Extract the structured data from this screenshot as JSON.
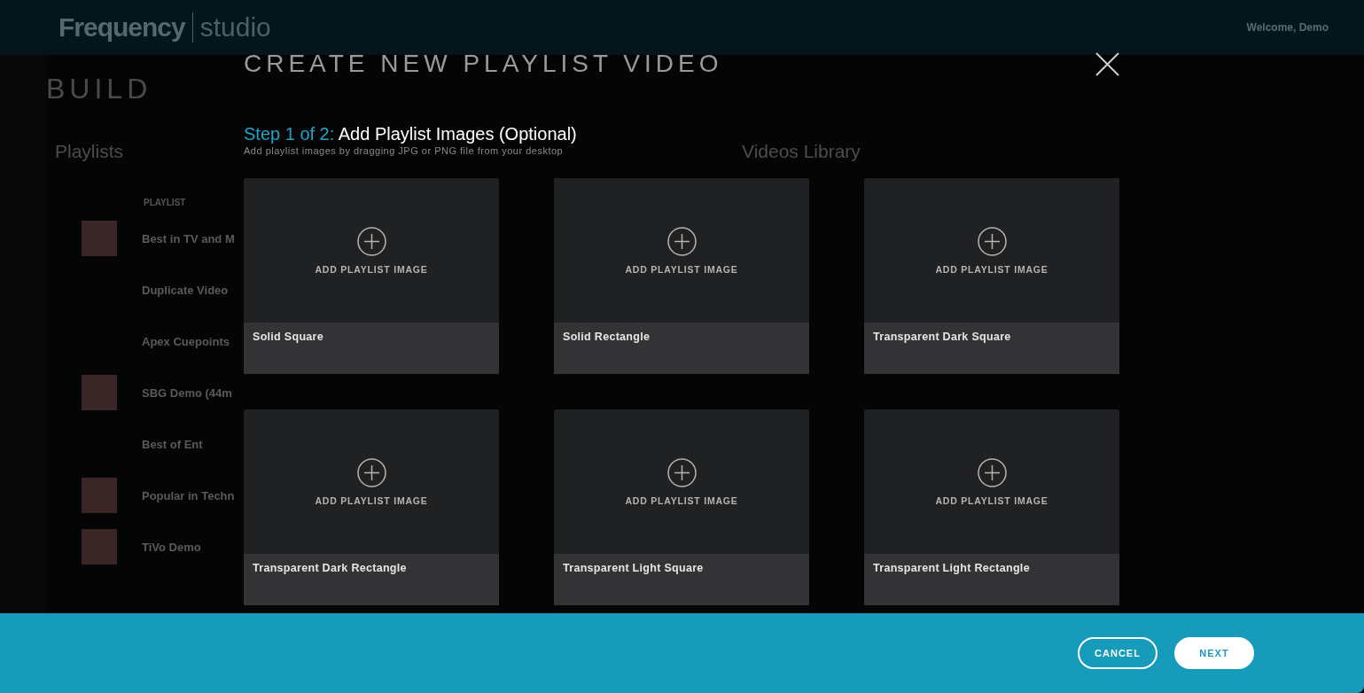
{
  "background": {
    "header": {
      "logo": "Frequency",
      "logo_suffix": "studio",
      "welcome": "Welcome, Demo"
    },
    "section_title": "BUILD",
    "playlists": {
      "title": "Playlists",
      "column": "PLAYLIST",
      "items": [
        {
          "name": "Best in TV and M",
          "thumbnail": true
        },
        {
          "name": "Duplicate Video",
          "thumbnail": false
        },
        {
          "name": "Apex Cuepoints",
          "thumbnail": false
        },
        {
          "name": "SBG Demo (44m",
          "thumbnail": true
        },
        {
          "name": "Best of Ent",
          "thumbnail": false
        },
        {
          "name": "Popular in Techn",
          "thumbnail": true
        },
        {
          "name": "TiVo Demo",
          "thumbnail": true
        }
      ]
    },
    "videos_library": {
      "title": "Videos Library"
    }
  },
  "dialog": {
    "title": "CREATE NEW PLAYLIST VIDEO",
    "step": "Step 1 of 2:",
    "heading": "Add Playlist Images (Optional)",
    "hint": "Add playlist images by dragging JPG or PNG file from your desktop",
    "slots": [
      {
        "action": "ADD PLAYLIST IMAGE",
        "label": "Solid Square"
      },
      {
        "action": "ADD PLAYLIST IMAGE",
        "label": "Solid Rectangle"
      },
      {
        "action": "ADD PLAYLIST IMAGE",
        "label": "Transparent Dark Square"
      },
      {
        "action": "ADD PLAYLIST IMAGE",
        "label": "Transparent Dark Rectangle"
      },
      {
        "action": "ADD PLAYLIST IMAGE",
        "label": "Transparent Light Square"
      },
      {
        "action": "ADD PLAYLIST IMAGE",
        "label": "Transparent Light Rectangle"
      }
    ],
    "buttons": [
      {
        "label": "CANCEL",
        "kind": "secondary"
      },
      {
        "label": "NEXT",
        "kind": "primary"
      }
    ]
  }
}
